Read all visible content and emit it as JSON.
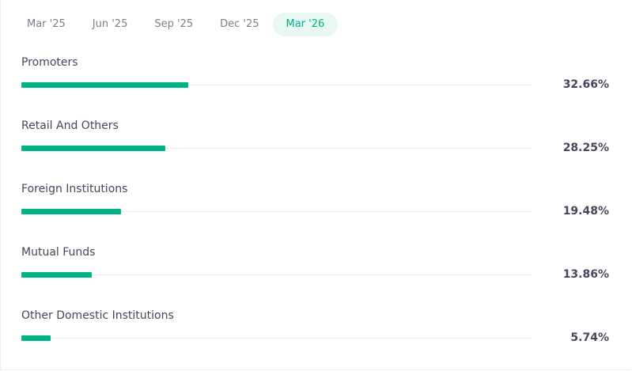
{
  "tabs": [
    {
      "label": "Mar '25",
      "active": false
    },
    {
      "label": "Jun '25",
      "active": false
    },
    {
      "label": "Sep '25",
      "active": false
    },
    {
      "label": "Dec '25",
      "active": false
    },
    {
      "label": "Mar '26",
      "active": true
    }
  ],
  "holdings": [
    {
      "label": "Promoters",
      "value_text": "32.66%",
      "value": 32.66
    },
    {
      "label": "Retail And Others",
      "value_text": "28.25%",
      "value": 28.25
    },
    {
      "label": "Foreign Institutions",
      "value_text": "19.48%",
      "value": 19.48
    },
    {
      "label": "Mutual Funds",
      "value_text": "13.86%",
      "value": 13.86
    },
    {
      "label": "Other Domestic Institutions",
      "value_text": "5.74%",
      "value": 5.74
    }
  ],
  "colors": {
    "accent": "#00b386",
    "active_tab_bg": "#e8f7f1",
    "track": "#ececec",
    "text": "#44475b",
    "muted_text": "#7c7e8c"
  }
}
